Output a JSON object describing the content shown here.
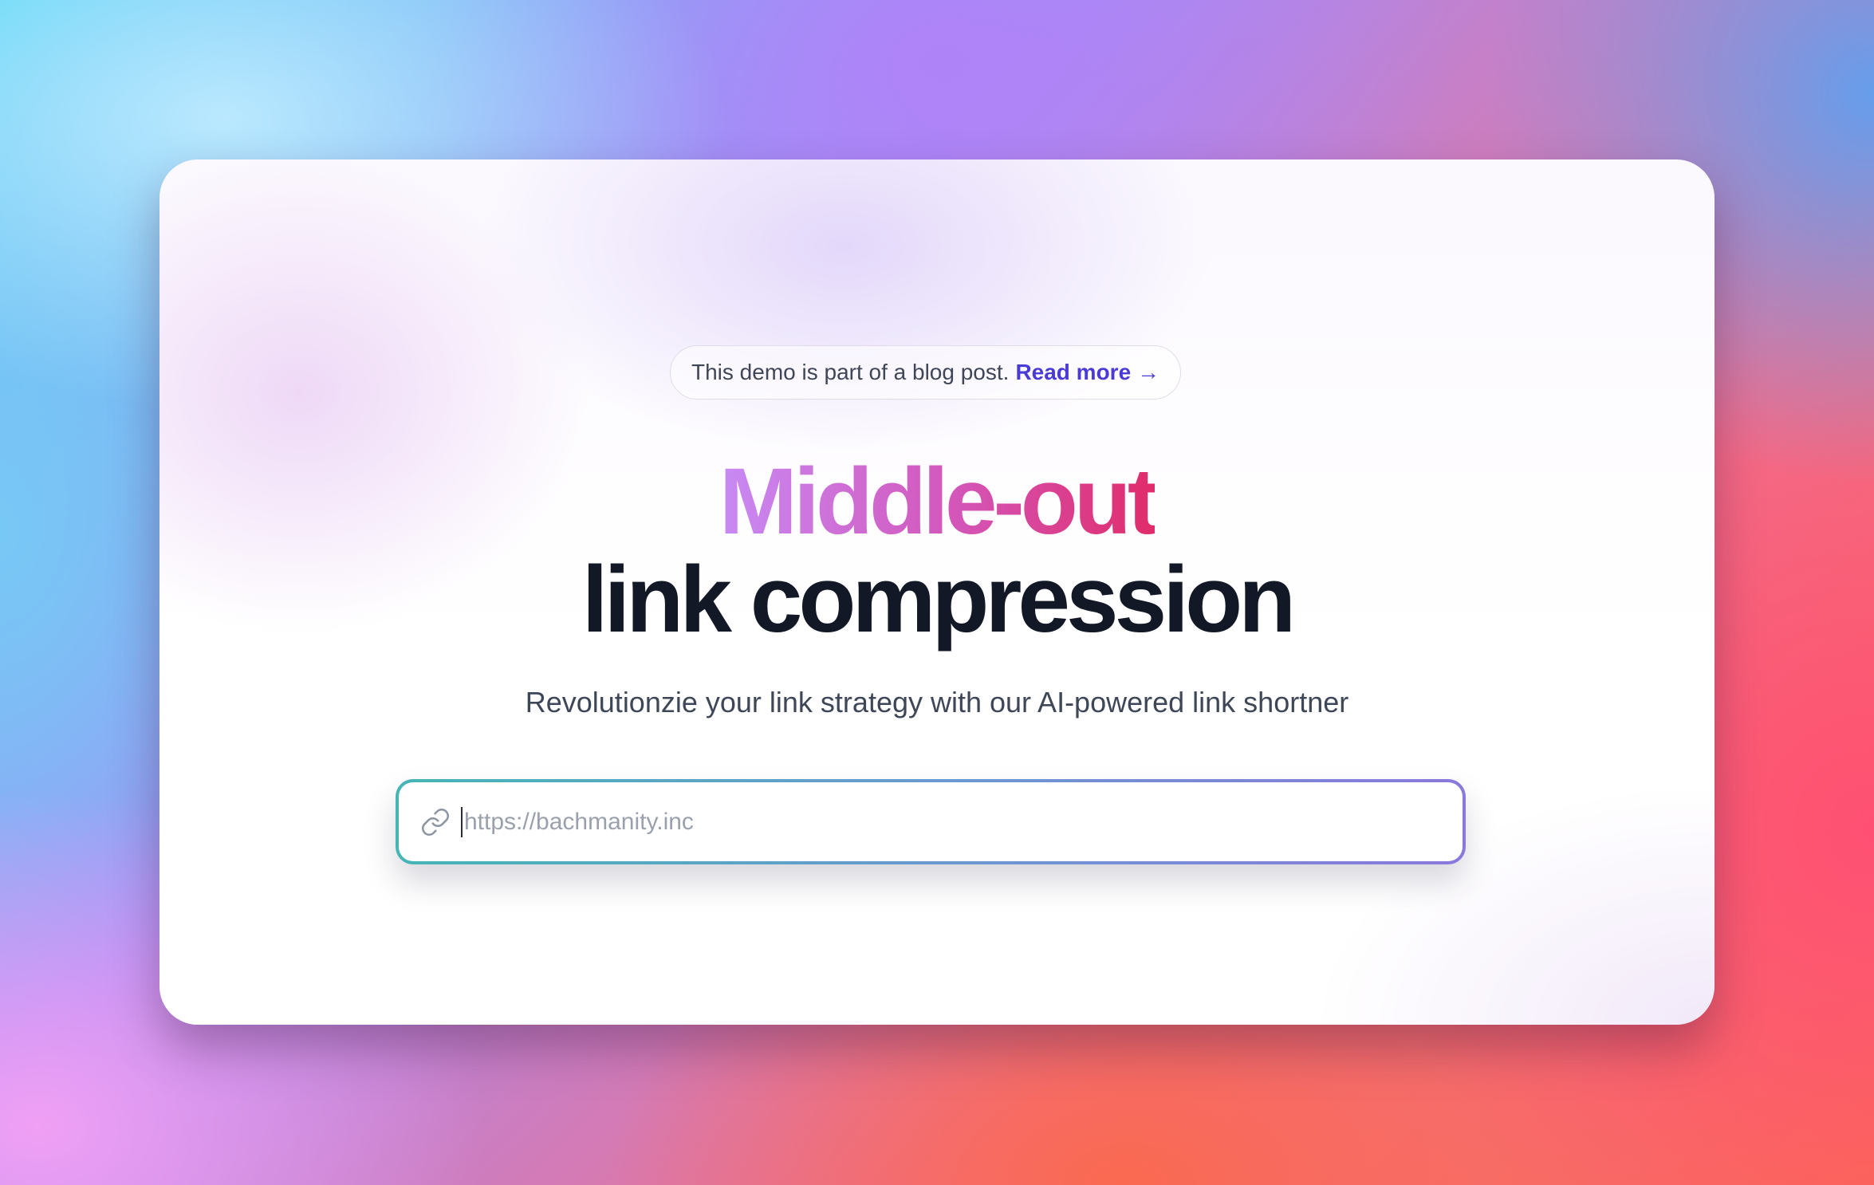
{
  "banner": {
    "text": "This demo is part of a blog post.",
    "link_label": "Read more",
    "arrow": "→"
  },
  "headline": {
    "line1": "Middle-out",
    "line2": "link compression"
  },
  "subtitle": "Revolutionzie your link strategy with our AI-powered link shortner",
  "url_input": {
    "placeholder": "https://bachmanity.inc",
    "value": "",
    "icon": "link-icon"
  },
  "colors": {
    "link_accent": "#4b3bd6",
    "headline_gradient_start": "#c88af5",
    "headline_gradient_end": "#e02c6a",
    "headline_dark": "#121826",
    "input_border_start": "#45b5b5",
    "input_border_end": "#8a78dc"
  }
}
